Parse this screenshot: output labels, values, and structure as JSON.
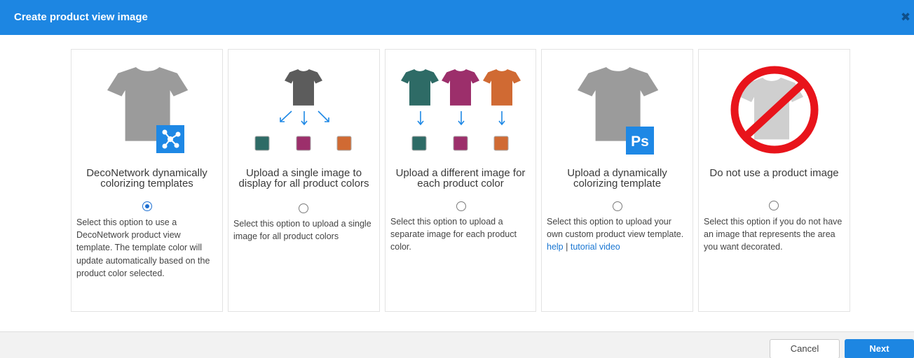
{
  "dialog": {
    "title": "Create product view image",
    "close_icon": "close-icon"
  },
  "colors": {
    "header": "#1d86e2",
    "shirt_gray": "#9b9b9b",
    "shirt_dark": "#5c5c5c",
    "teal": "#2e6b66",
    "magenta": "#9c2f6b",
    "orange": "#d06a33",
    "forbidden": "#e8141b"
  },
  "options": [
    {
      "title": "DecoNetwork dynamically colorizing templates",
      "description": "Select this option to use a DecoNetwork product view template. The template color will update automatically based on the product color selected.",
      "selected": true,
      "icon": "deconetwork-logo-icon"
    },
    {
      "title": "Upload a single image to display for all product colors",
      "description": "Select this option to upload a single image for all product colors",
      "selected": false,
      "icon": "tshirt-icon"
    },
    {
      "title": "Upload a different image for each product color",
      "description": "Select this option to upload a separate image for each product color.",
      "selected": false,
      "icon": "tshirt-icon"
    },
    {
      "title": "Upload a dynamically colorizing template",
      "description": "Select this option to upload your own custom product view template.",
      "help_link": "help",
      "separator": "|",
      "video_link": "tutorial video",
      "selected": false,
      "icon": "photoshop-icon"
    },
    {
      "title": "Do not use a product image",
      "description": "Select this option if you do not have an image that represents the area you want decorated.",
      "selected": false,
      "icon": "no-image-icon"
    }
  ],
  "footer": {
    "cancel_label": "Cancel",
    "next_label": "Next"
  }
}
